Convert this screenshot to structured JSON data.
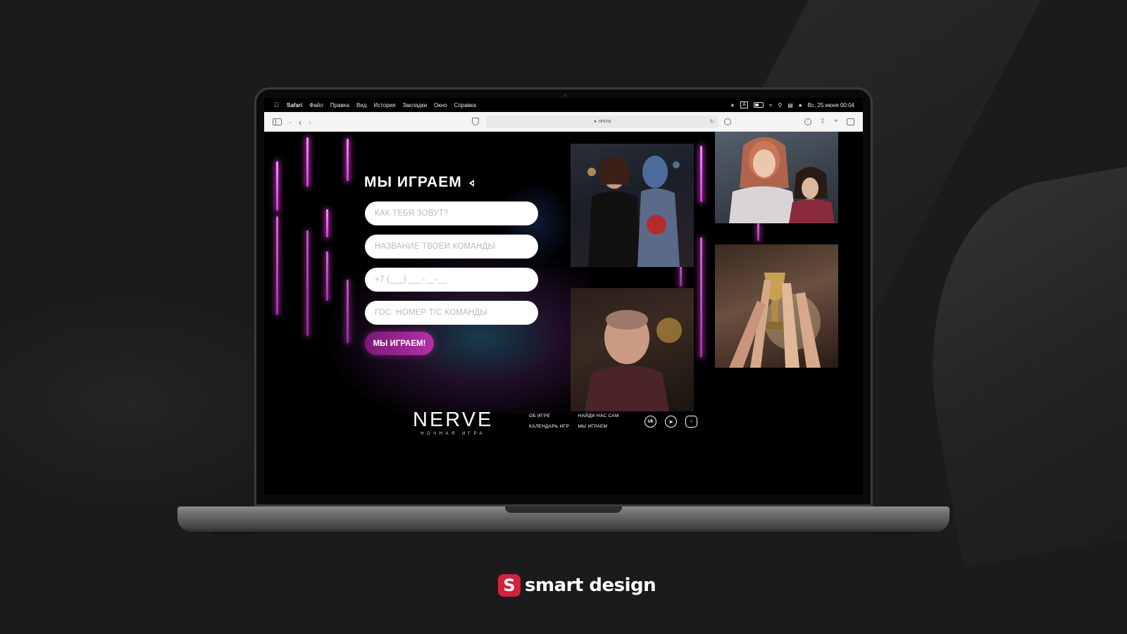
{
  "menubar": {
    "app": "Safari",
    "items": [
      "Файл",
      "Правка",
      "Вид",
      "История",
      "Закладки",
      "Окно",
      "Справка"
    ],
    "input_indicator": "A",
    "datetime": "Вс, 25 июня  00:04"
  },
  "browser": {
    "url": "nrv.ru"
  },
  "site": {
    "form": {
      "title": "МЫ ИГРАЕМ",
      "name_placeholder": "КАК ТЕБЯ ЗОВУТ?",
      "team_placeholder": "НАЗВАНИЕ ТВОЕЙ КОМАНДЫ",
      "phone_placeholder": "+7 (___) ___-__-__",
      "plate_placeholder": "ГОС. НОМЕР Т/С КОМАНДЫ",
      "submit_label": "МЫ ИГРАЕМ!"
    },
    "footer": {
      "logo": "NERVE",
      "logo_sub": "НОЧНАЯ ИГРА",
      "links": [
        "ОБ ИГРЕ",
        "НАЙДИ НАС САМ",
        "КАЛЕНДАРЬ ИГР",
        "МЫ ИГРАЕМ"
      ],
      "social": [
        "vk-icon",
        "telegram-icon",
        "instagram-icon"
      ]
    },
    "accent_color": "#b52fa8"
  },
  "brand": {
    "name": "smart design",
    "icon_letter": "S",
    "color": "#d4213d"
  }
}
